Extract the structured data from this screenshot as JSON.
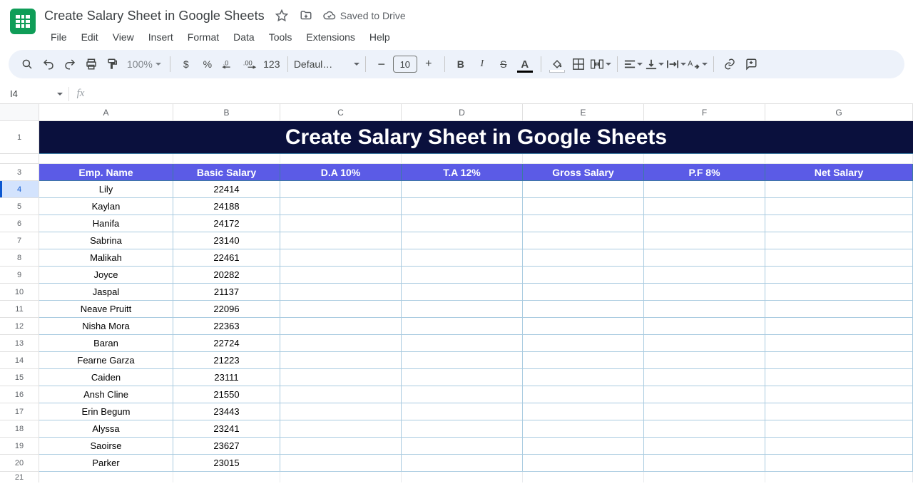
{
  "header": {
    "doc_title": "Create Salary Sheet in Google Sheets",
    "saved_label": "Saved to Drive",
    "menus": [
      "File",
      "Edit",
      "View",
      "Insert",
      "Format",
      "Data",
      "Tools",
      "Extensions",
      "Help"
    ]
  },
  "toolbar": {
    "zoom": "100%",
    "currency": "$",
    "percent": "%",
    "dec_dec": ".0",
    "inc_dec": ".00",
    "num_fmt": "123",
    "font_name": "Defaul…",
    "font_size": "10"
  },
  "fx": {
    "name_box": "I4",
    "formula": ""
  },
  "grid": {
    "col_letters": [
      "A",
      "B",
      "C",
      "D",
      "E",
      "F",
      "G"
    ],
    "row_nums_visible": [
      "1",
      "3",
      "4",
      "5",
      "6",
      "7",
      "8",
      "9",
      "10",
      "11",
      "12",
      "13",
      "14",
      "15",
      "16",
      "17",
      "18",
      "19",
      "20",
      "21"
    ],
    "banner_title": "Create Salary Sheet in Google Sheets",
    "headers": [
      "Emp. Name",
      "Basic Salary",
      "D.A 10%",
      "T.A 12%",
      "Gross Salary",
      "P.F 8%",
      "Net Salary"
    ],
    "rows": [
      {
        "name": "Lily",
        "basic": "22414"
      },
      {
        "name": "Kaylan",
        "basic": "24188"
      },
      {
        "name": "Hanifa",
        "basic": "24172"
      },
      {
        "name": "Sabrina",
        "basic": "23140"
      },
      {
        "name": "Malikah",
        "basic": "22461"
      },
      {
        "name": "Joyce",
        "basic": "20282"
      },
      {
        "name": "Jaspal",
        "basic": "21137"
      },
      {
        "name": "Neave Pruitt",
        "basic": "22096"
      },
      {
        "name": "Nisha Mora",
        "basic": "22363"
      },
      {
        "name": "Baran",
        "basic": "22724"
      },
      {
        "name": "Fearne Garza",
        "basic": "21223"
      },
      {
        "name": "Caiden",
        "basic": "23111"
      },
      {
        "name": "Ansh Cline",
        "basic": "21550"
      },
      {
        "name": "Erin Begum",
        "basic": "23443"
      },
      {
        "name": "Alyssa",
        "basic": "23241"
      },
      {
        "name": "Saoirse",
        "basic": "23627"
      },
      {
        "name": "Parker",
        "basic": "23015"
      }
    ]
  },
  "chart_data": {
    "type": "table",
    "title": "Create Salary Sheet in Google Sheets",
    "columns": [
      "Emp. Name",
      "Basic Salary",
      "D.A 10%",
      "T.A 12%",
      "Gross Salary",
      "P.F 8%",
      "Net Salary"
    ],
    "rows": [
      [
        "Lily",
        22414,
        null,
        null,
        null,
        null,
        null
      ],
      [
        "Kaylan",
        24188,
        null,
        null,
        null,
        null,
        null
      ],
      [
        "Hanifa",
        24172,
        null,
        null,
        null,
        null,
        null
      ],
      [
        "Sabrina",
        23140,
        null,
        null,
        null,
        null,
        null
      ],
      [
        "Malikah",
        22461,
        null,
        null,
        null,
        null,
        null
      ],
      [
        "Joyce",
        20282,
        null,
        null,
        null,
        null,
        null
      ],
      [
        "Jaspal",
        21137,
        null,
        null,
        null,
        null,
        null
      ],
      [
        "Neave Pruitt",
        22096,
        null,
        null,
        null,
        null,
        null
      ],
      [
        "Nisha Mora",
        22363,
        null,
        null,
        null,
        null,
        null
      ],
      [
        "Baran",
        22724,
        null,
        null,
        null,
        null,
        null
      ],
      [
        "Fearne Garza",
        21223,
        null,
        null,
        null,
        null,
        null
      ],
      [
        "Caiden",
        23111,
        null,
        null,
        null,
        null,
        null
      ],
      [
        "Ansh Cline",
        21550,
        null,
        null,
        null,
        null,
        null
      ],
      [
        "Erin Begum",
        23443,
        null,
        null,
        null,
        null,
        null
      ],
      [
        "Alyssa",
        23241,
        null,
        null,
        null,
        null,
        null
      ],
      [
        "Saoirse",
        23627,
        null,
        null,
        null,
        null,
        null
      ],
      [
        "Parker",
        23015,
        null,
        null,
        null,
        null,
        null
      ]
    ]
  }
}
